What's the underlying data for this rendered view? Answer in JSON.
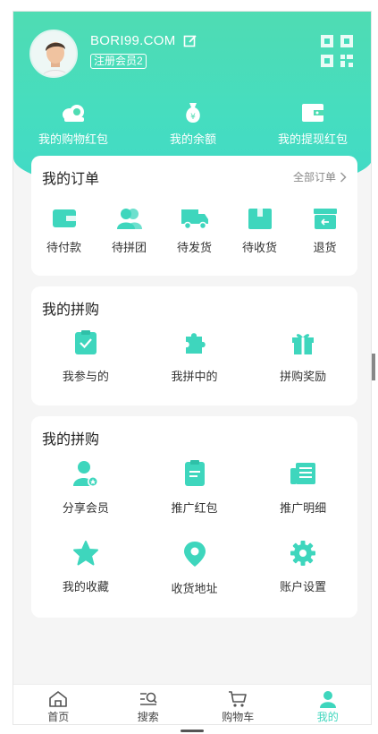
{
  "profile": {
    "username": "BORI99.COM",
    "badge": "注册会员2"
  },
  "wallet": [
    {
      "label": "我的购物红包",
      "icon": "cloud-coins-icon"
    },
    {
      "label": "我的余额",
      "icon": "money-bag-icon"
    },
    {
      "label": "我的提现红包",
      "icon": "wallet-icon"
    }
  ],
  "orders": {
    "title": "我的订单",
    "all_label": "全部订单",
    "items": [
      {
        "label": "待付款",
        "icon": "wallet-card-icon"
      },
      {
        "label": "待拼团",
        "icon": "group-users-icon"
      },
      {
        "label": "待发货",
        "icon": "truck-icon"
      },
      {
        "label": "待收货",
        "icon": "box-icon"
      },
      {
        "label": "退货",
        "icon": "return-box-icon"
      }
    ]
  },
  "group_buy": {
    "title": "我的拼购",
    "items": [
      {
        "label": "我参与的",
        "icon": "clipboard-check-icon"
      },
      {
        "label": "我拼中的",
        "icon": "puzzle-icon"
      },
      {
        "label": "拼购奖励",
        "icon": "gift-icon"
      }
    ]
  },
  "promo": {
    "title": "我的拼购",
    "items": [
      {
        "label": "分享会员",
        "icon": "member-star-icon"
      },
      {
        "label": "推广红包",
        "icon": "document-icon"
      },
      {
        "label": "推广明细",
        "icon": "newspaper-icon"
      },
      {
        "label": "我的收藏",
        "icon": "star-icon"
      },
      {
        "label": "收货地址",
        "icon": "location-pin-icon"
      },
      {
        "label": "账户设置",
        "icon": "gear-icon"
      }
    ]
  },
  "tabbar": [
    {
      "label": "首页",
      "icon": "home-icon",
      "active": false
    },
    {
      "label": "搜索",
      "icon": "search-list-icon",
      "active": false
    },
    {
      "label": "购物车",
      "icon": "cart-icon",
      "active": false
    },
    {
      "label": "我的",
      "icon": "user-icon",
      "active": true
    }
  ],
  "colors": {
    "accent": "#3ed6bd",
    "header_top": "#4fdcb3",
    "header_bottom": "#41d9c7"
  }
}
